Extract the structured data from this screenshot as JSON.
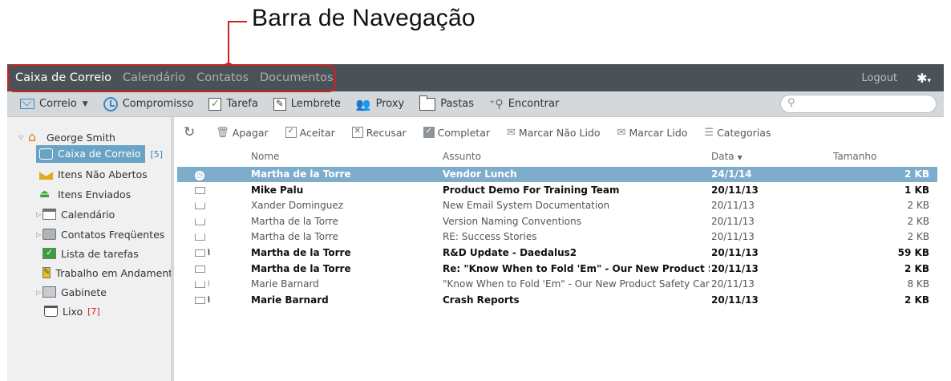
{
  "annotation": {
    "title": "Barra de Navegação"
  },
  "topnav": {
    "tabs": [
      {
        "label": "Caixa de Correio",
        "active": true
      },
      {
        "label": "Calendário"
      },
      {
        "label": "Contatos"
      },
      {
        "label": "Documentos"
      }
    ],
    "logout": "Logout",
    "settings_icon": "gear-icon"
  },
  "toolbar": {
    "correio": "Correio",
    "compromisso": "Compromisso",
    "tarefa": "Tarefa",
    "lembrete": "Lembrete",
    "proxy": "Proxy",
    "pastas": "Pastas",
    "encontrar": "Encontrar",
    "search_value": ""
  },
  "sidebar": {
    "user": "George Smith",
    "items": [
      {
        "label": "Caixa de Correio",
        "count": "[5]",
        "selected": true
      },
      {
        "label": "Itens Não Abertos"
      },
      {
        "label": "Itens Enviados"
      },
      {
        "label": "Calendário"
      },
      {
        "label": "Contatos Freqüentes"
      },
      {
        "label": "Lista de tarefas"
      },
      {
        "label": "Trabalho em Andamento"
      },
      {
        "label": "Gabinete"
      },
      {
        "label": "Lixo",
        "count": "[7]"
      }
    ]
  },
  "actions": {
    "apagar": "Apagar",
    "aceitar": "Aceitar",
    "recusar": "Recusar",
    "completar": "Completar",
    "marcar_nao_lido": "Marcar Não Lido",
    "marcar_lido": "Marcar Lido",
    "categorias": "Categorias"
  },
  "columns": {
    "nome": "Nome",
    "assunto": "Assunto",
    "data": "Data",
    "tamanho": "Tamanho"
  },
  "messages": [
    {
      "icon": "clock-icon",
      "name": "Martha de la Torre",
      "subject": "Vendor Lunch",
      "date": "24/1/14",
      "size": "2 KB",
      "unread": true,
      "selected": true
    },
    {
      "icon": "envelope-icon",
      "name": "Mike Palu",
      "subject": "Product Demo For Training Team",
      "date": "20/11/13",
      "size": "1 KB",
      "unread": true
    },
    {
      "icon": "open-envelope-icon",
      "name": "Xander Dominguez",
      "subject": "New Email System Documentation",
      "date": "20/11/13",
      "size": "2 KB"
    },
    {
      "icon": "open-envelope-icon",
      "name": "Martha de la Torre",
      "subject": "Version Naming Conventions",
      "date": "20/11/13",
      "size": "2 KB"
    },
    {
      "icon": "open-envelope-icon",
      "name": "Martha de la Torre",
      "subject": "RE: Success Stories",
      "date": "20/11/13",
      "size": "2 KB"
    },
    {
      "icon": "envelope-attachment-icon",
      "name": "Martha de la Torre",
      "subject": "R&D Update - Daedalus2",
      "date": "20/11/13",
      "size": "59 KB",
      "unread": true
    },
    {
      "icon": "envelope-icon",
      "name": "Martha de la Torre",
      "subject": "Re: \"Know When to Fold 'Em\" - Our New Product Safety",
      "date": "20/11/13",
      "size": "2 KB",
      "unread": true
    },
    {
      "icon": "open-envelope-attachment-icon",
      "name": "Marie Barnard",
      "subject": "\"Know When to Fold 'Em\" - Our New Product Safety Campa",
      "date": "20/11/13",
      "size": "8 KB"
    },
    {
      "icon": "envelope-attachment-icon",
      "name": "Marie Barnard",
      "subject": "Crash Reports",
      "date": "20/11/13",
      "size": "2 KB",
      "unread": true
    }
  ]
}
